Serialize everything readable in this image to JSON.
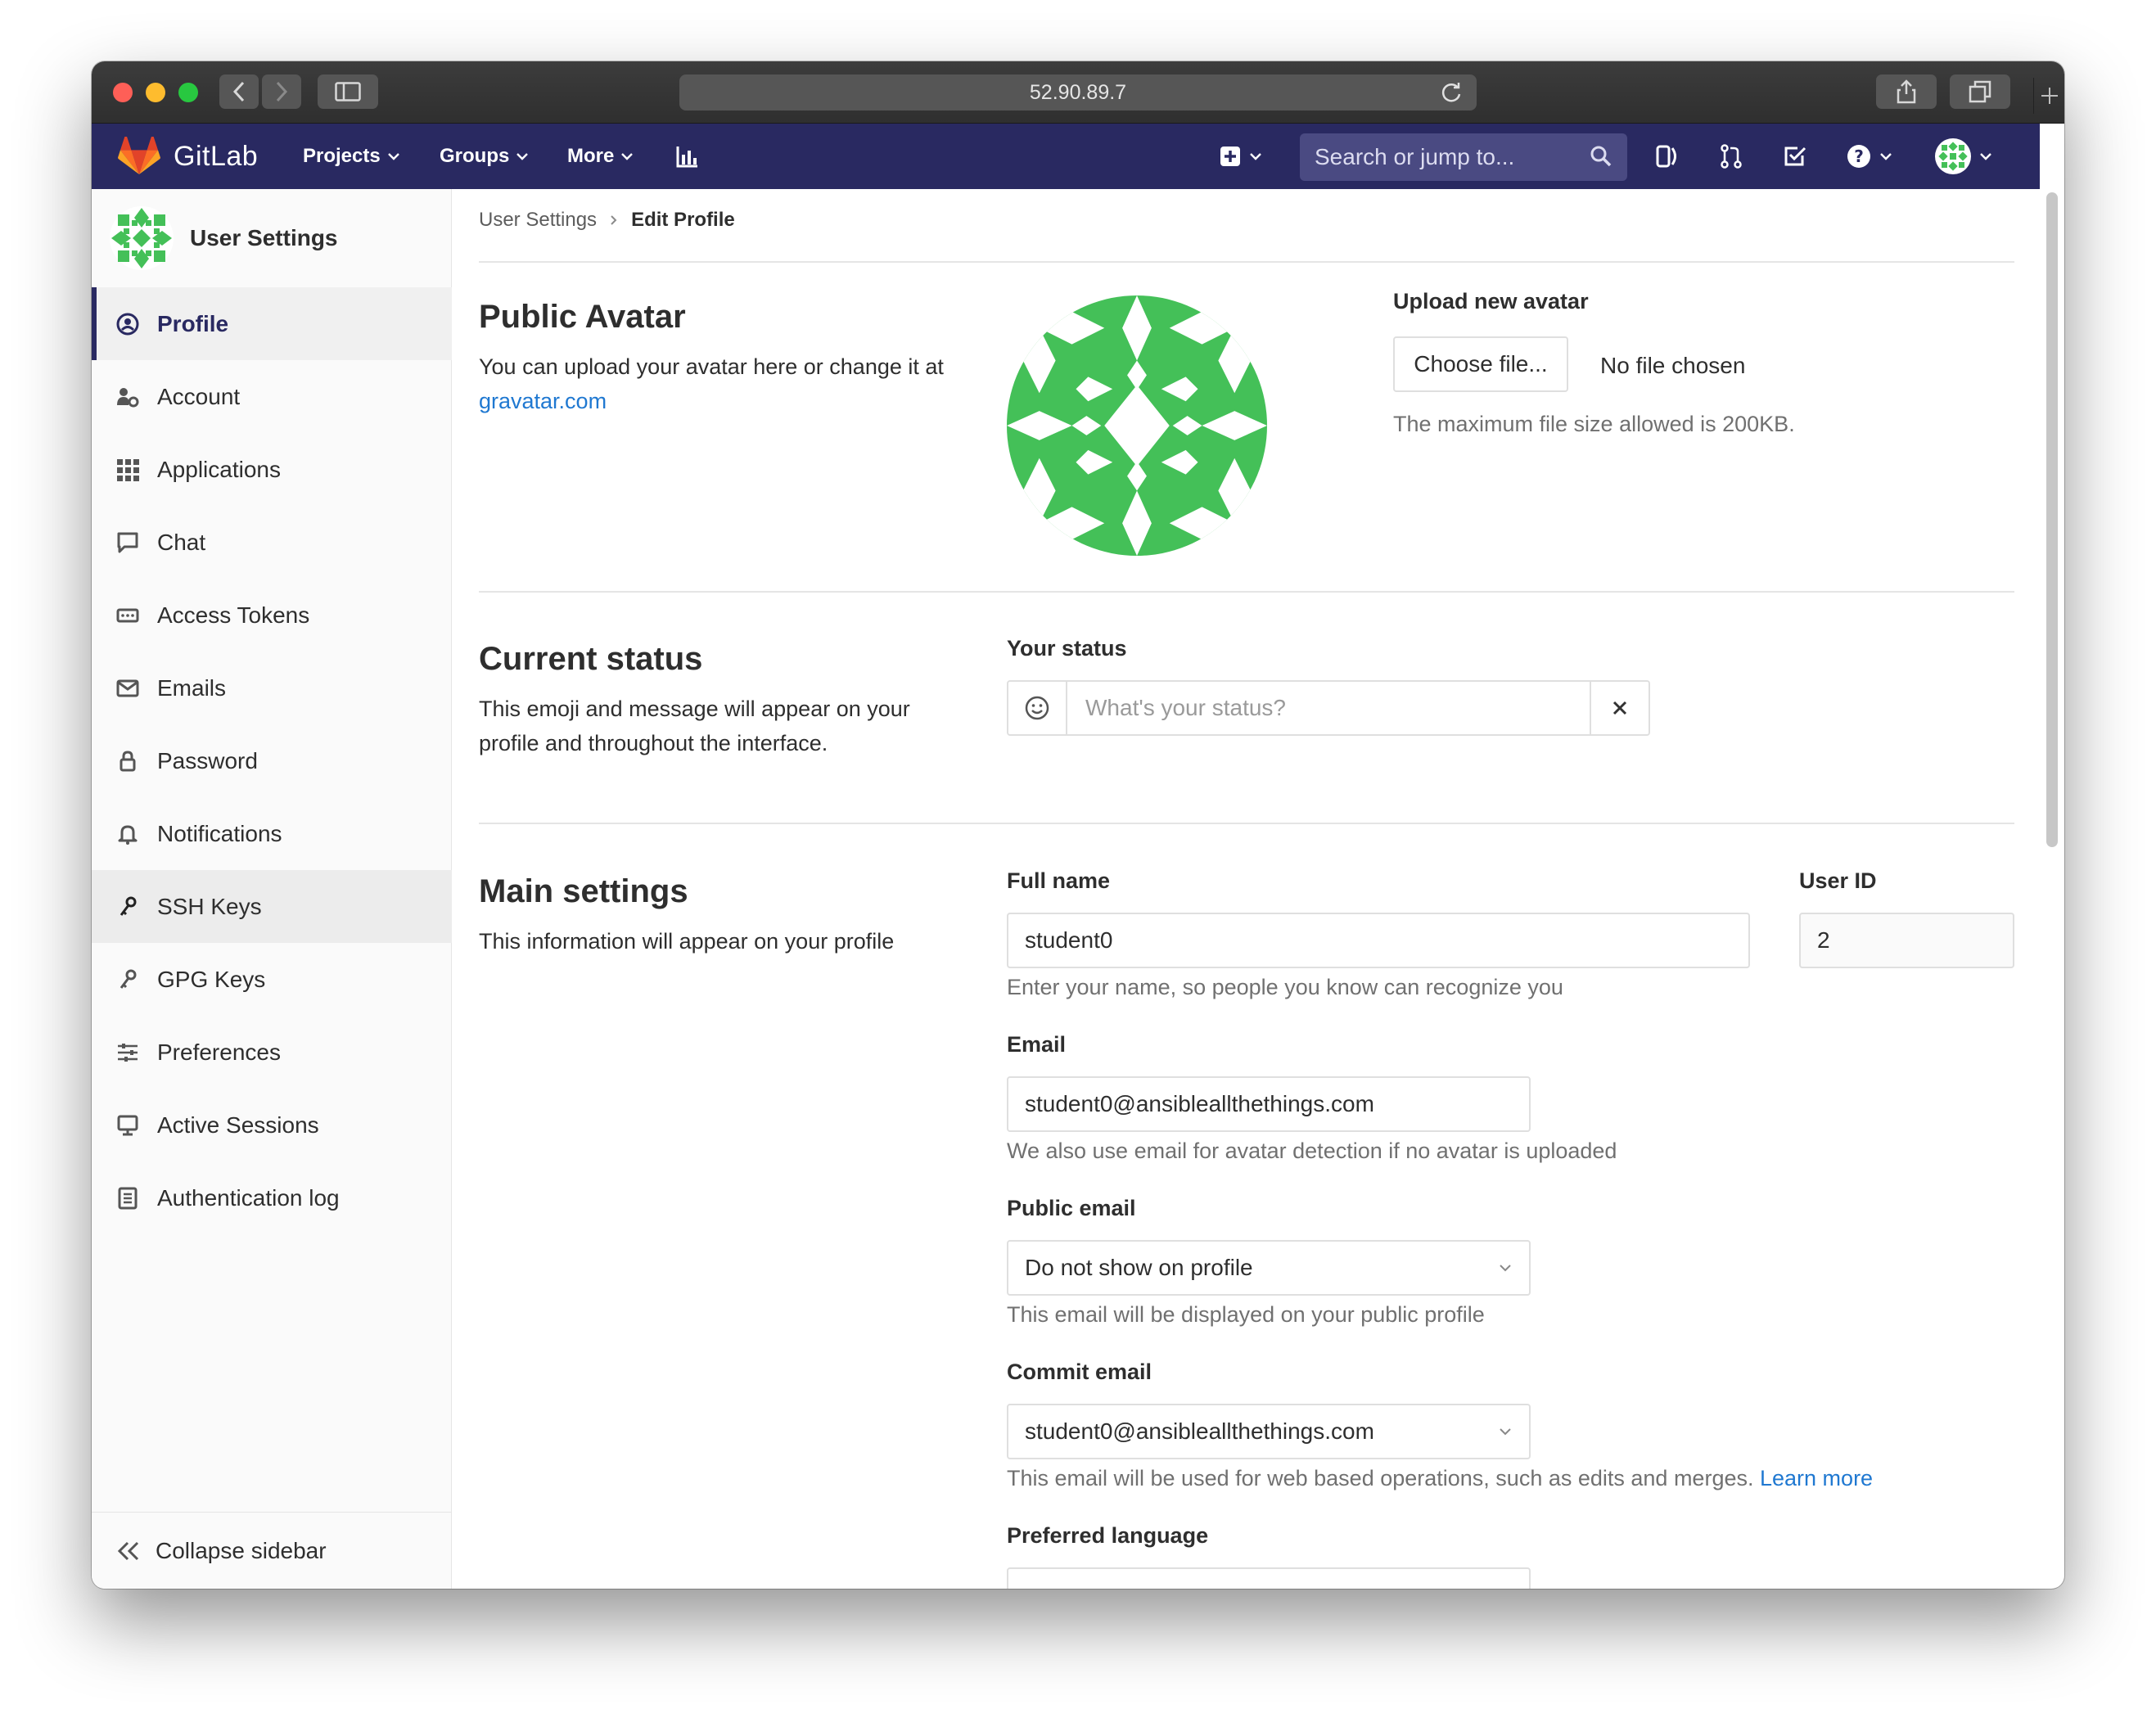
{
  "browser": {
    "url": "52.90.89.7"
  },
  "navbar": {
    "brand": "GitLab",
    "projects": "Projects",
    "groups": "Groups",
    "more": "More",
    "search_placeholder": "Search or jump to..."
  },
  "sidebar": {
    "title": "User Settings",
    "items": [
      {
        "label": "Profile",
        "icon": "profile-icon"
      },
      {
        "label": "Account",
        "icon": "account-icon"
      },
      {
        "label": "Applications",
        "icon": "applications-icon"
      },
      {
        "label": "Chat",
        "icon": "chat-icon"
      },
      {
        "label": "Access Tokens",
        "icon": "token-icon"
      },
      {
        "label": "Emails",
        "icon": "envelope-icon"
      },
      {
        "label": "Password",
        "icon": "lock-icon"
      },
      {
        "label": "Notifications",
        "icon": "bell-icon"
      },
      {
        "label": "SSH Keys",
        "icon": "key-icon"
      },
      {
        "label": "GPG Keys",
        "icon": "key-icon"
      },
      {
        "label": "Preferences",
        "icon": "sliders-icon"
      },
      {
        "label": "Active Sessions",
        "icon": "monitor-icon"
      },
      {
        "label": "Authentication log",
        "icon": "log-icon"
      }
    ],
    "collapse_label": "Collapse sidebar"
  },
  "breadcrumb": {
    "parent": "User Settings",
    "current": "Edit Profile"
  },
  "avatar_section": {
    "title": "Public Avatar",
    "desc_prefix": "You can upload your avatar here or change it at ",
    "desc_link": "gravatar.com",
    "upload_label": "Upload new avatar",
    "choose_button": "Choose file...",
    "no_file": "No file chosen",
    "max_size": "The maximum file size allowed is 200KB."
  },
  "status_section": {
    "title": "Current status",
    "desc": "This emoji and message will appear on your profile and throughout the interface.",
    "label": "Your status",
    "placeholder": "What's your status?"
  },
  "main_settings": {
    "title": "Main settings",
    "desc": "This information will appear on your profile",
    "full_name_label": "Full name",
    "full_name_value": "student0",
    "full_name_help": "Enter your name, so people you know can recognize you",
    "user_id_label": "User ID",
    "user_id_value": "2",
    "email_label": "Email",
    "email_value": "student0@ansibleallthethings.com",
    "email_help": "We also use email for avatar detection if no avatar is uploaded",
    "public_email_label": "Public email",
    "public_email_value": "Do not show on profile",
    "public_email_help": "This email will be displayed on your public profile",
    "commit_email_label": "Commit email",
    "commit_email_value": "student0@ansibleallthethings.com",
    "commit_email_help": "This email will be used for web based operations, such as edits and merges.",
    "commit_email_link": "Learn more",
    "language_label": "Preferred language"
  },
  "colors": {
    "nav_bg": "#292961",
    "avatar_green": "#44c058",
    "link": "#1f78d1"
  }
}
